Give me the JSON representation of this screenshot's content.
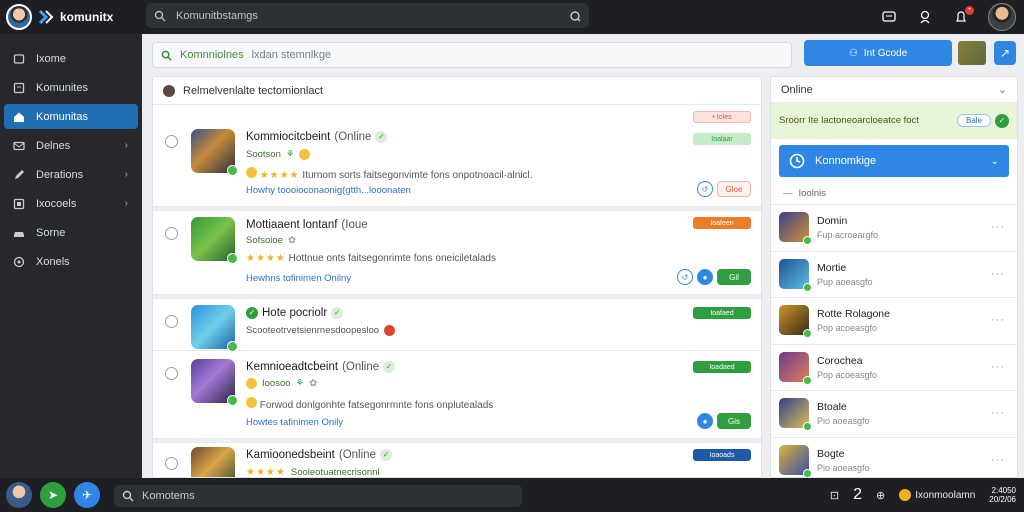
{
  "colors": {
    "accent": "#2f86e4",
    "topbar": "#1d1f22",
    "sidebar": "#26282c",
    "success": "#2e9e3e",
    "warning": "#ea7c2a"
  },
  "brand": {
    "name": "komunitx"
  },
  "top_search": {
    "value": "Komunitbstamgs"
  },
  "top_icons": [
    "chat-icon",
    "notification-icon",
    "alert-icon"
  ],
  "sidebar": {
    "items": [
      {
        "label": "Ixome",
        "icon": "home-icon",
        "chevron": false
      },
      {
        "label": "Komunites",
        "icon": "community-icon",
        "chevron": false
      },
      {
        "label": "Komunitas",
        "icon": "house-icon",
        "chevron": false,
        "active": true
      },
      {
        "label": "Delnes",
        "icon": "mail-icon",
        "chevron": true
      },
      {
        "label": "Derations",
        "icon": "edit-icon",
        "chevron": true
      },
      {
        "label": "Ixocoels",
        "icon": "book-icon",
        "chevron": true
      },
      {
        "label": "Sorne",
        "icon": "car-icon",
        "chevron": false
      },
      {
        "label": "Xonels",
        "icon": "globe-icon",
        "chevron": false
      }
    ]
  },
  "subbar": {
    "search_left": "Komnniolnes",
    "search_placeholder": "lxdan stemnlkge",
    "primary_button": "Int Gcode"
  },
  "feed": {
    "header": "Relmelvenlalte tectomionlact",
    "cards": [
      {
        "title": "Kommiocitcbeint",
        "status": "(Online",
        "sub": "Sootson",
        "stars": "★★★★",
        "desc": "Iturnom sorts faitsegonvimte fons onpotnoacil·alnicl.",
        "link": "Howhy toooioconaonig(gtth...looonaten",
        "tag": "• Ioles",
        "tag_style": "pink",
        "actions": [
          "ring",
          "outline"
        ],
        "action_label": "Gloe",
        "top_tag": "Ioalaar",
        "top_tag_style": "lightgreen"
      },
      {
        "title": "Mottiaaent lontanf",
        "status": "(Ioue",
        "sub": "Sofsoioe",
        "stars": "★★★★",
        "desc": "Hottnue onts faitsegonrimte fons oneiciletalads",
        "link": "Hewhns tofinimen Onilny",
        "tag": "Ioafeen",
        "tag_style": "orange",
        "actions": [
          "ring",
          "blue",
          "green"
        ],
        "action_label": "Gil"
      },
      {
        "title": "Hote pocriolr",
        "status": "",
        "sub": "Scooteotrvetsienrnesdoopesloo",
        "stars": "",
        "desc": "",
        "link": "",
        "tag": "Ioafaed",
        "tag_style": "green",
        "actions": []
      },
      {
        "title": "Kemnioeadtcbeint",
        "status": "(Online",
        "sub": "Ioosoo",
        "stars": "",
        "desc": "Forwod donlgonhte fatsegonrmnte fons onplutealads",
        "link": "Howtes tafinimen Onily",
        "tag": "Ioadaed",
        "tag_style": "green",
        "actions": [
          "blue",
          "green"
        ],
        "action_label": "Gis"
      },
      {
        "title": "Kamioonedsbeint",
        "status": "(Online",
        "sub": "Sooleotuatnecrisonnl",
        "stars": "★★★★",
        "desc": "",
        "link": "",
        "tag": "Ioaoads",
        "tag_style": "blue",
        "actions": []
      }
    ]
  },
  "right_panel": {
    "header": "Online",
    "banner_text": "Sroorr Ite lactoneoarcloeatce foct",
    "banner_pill": "Bale",
    "select_label": "Konnomkige",
    "sub_label": "Ioolnis",
    "people": [
      {
        "name": "Domin",
        "status": "Fup acroeargfo"
      },
      {
        "name": "Mortie",
        "status": "Pup aoeasgfo"
      },
      {
        "name": "Rotte Rolagone",
        "status": "Pop acoeasgfo"
      },
      {
        "name": "Corochea",
        "status": "Pop acoeasgfo"
      },
      {
        "name": "Btoale",
        "status": "Pio aoeasgfo"
      },
      {
        "name": "Bogte",
        "status": "Pio aoeasgfo"
      }
    ]
  },
  "bottombar": {
    "search": "Komotems",
    "count": "2",
    "coin_label": "Ixonmoolamn",
    "clock_line1": "2:4050",
    "clock_line2": "20/2/06"
  }
}
